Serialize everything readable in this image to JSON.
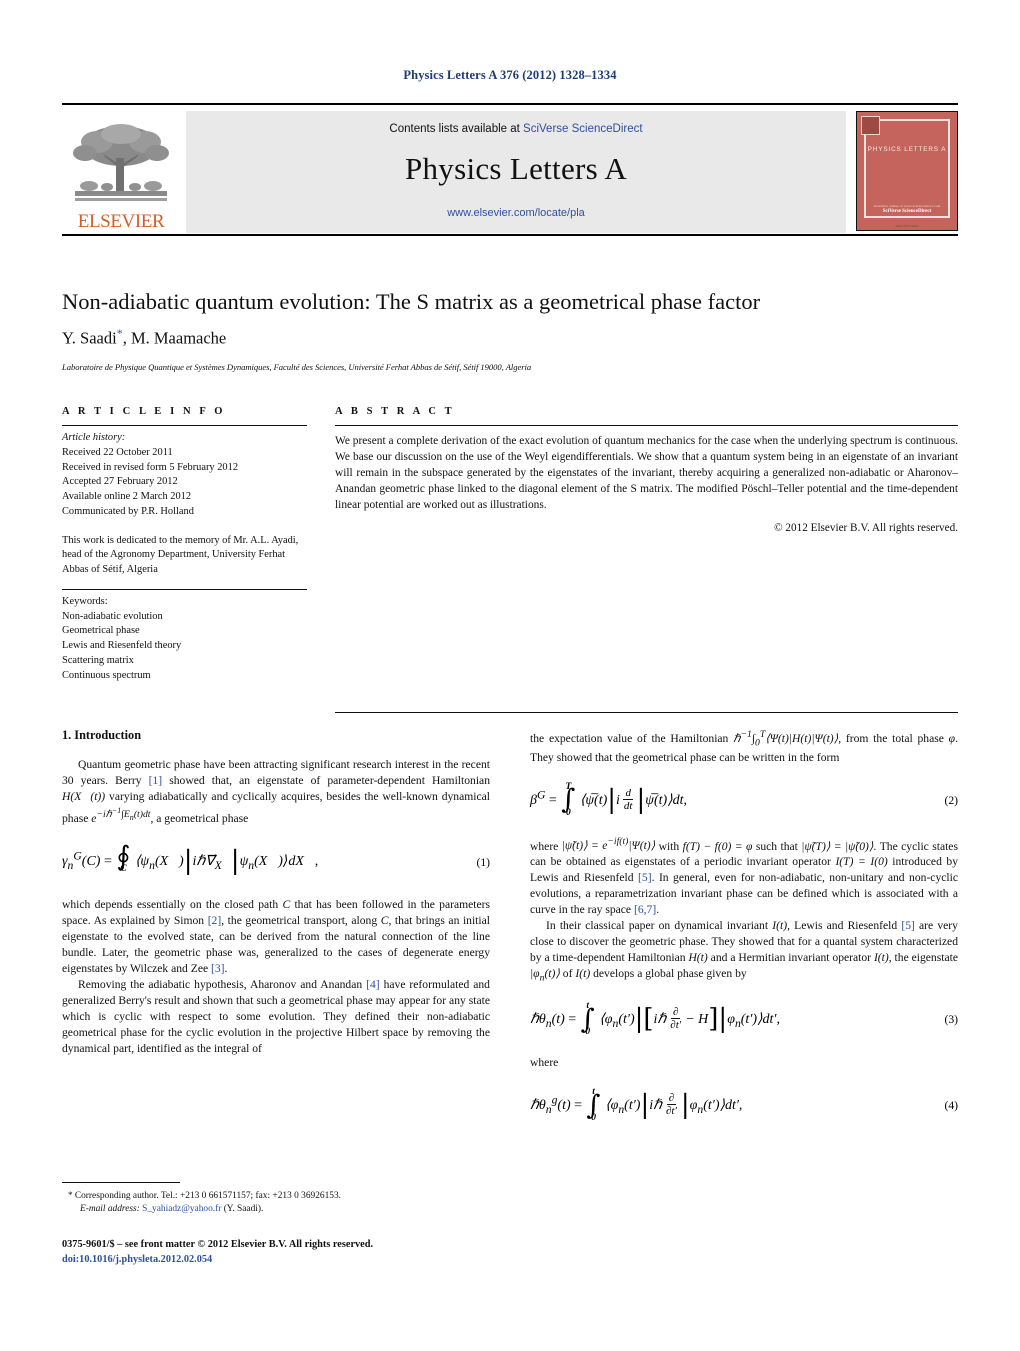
{
  "running_head": "Physics Letters A 376 (2012) 1328–1334",
  "masthead": {
    "contents_prefix": "Contents lists available at ",
    "contents_link": "SciVerse ScienceDirect",
    "journal_title": "Physics Letters A",
    "journal_url": "www.elsevier.com/locate/pla",
    "publisher_word": "ELSEVIER",
    "cover": {
      "name": "PHYSICS LETTERS A",
      "foot1": "Available online at www.sciencedirect.com",
      "foot2": "SciVerse ScienceDirect",
      "foot3": "ISSN 0375-9601"
    },
    "colors": {
      "link": "#2d4fa0",
      "band": "#e9e9e9",
      "elsevier_orange": "#d25f26",
      "cover_red": "#c4645c"
    }
  },
  "title": "Non-adiabatic quantum evolution: The S matrix as a geometrical phase factor",
  "authors": "Y. Saadi",
  "authors_rest": ", M. Maamache",
  "author_marker": "*",
  "affiliation": "Laboratoire de Physique Quantique et Systèmes Dynamiques, Faculté des Sciences, Université Ferhat Abbas de Sétif, Sétif 19000, Algeria",
  "article_info": {
    "heading": "A R T I C L E    I N F O",
    "history_label": "Article history:",
    "history": [
      "Received 22 October 2011",
      "Received in revised form 5 February 2012",
      "Accepted 27 February 2012",
      "Available online 2 March 2012",
      "Communicated by P.R. Holland"
    ],
    "dedication": "This work is dedicated to the memory of Mr. A.L. Ayadi, head of the Agronomy Department, University Ferhat Abbas of Sétif, Algeria",
    "keywords_label": "Keywords:",
    "keywords": [
      "Non-adiabatic evolution",
      "Geometrical phase",
      "Lewis and Riesenfeld theory",
      "Scattering matrix",
      "Continuous spectrum"
    ]
  },
  "abstract": {
    "heading": "A B S T R A C T",
    "text": "We present a complete derivation of the exact evolution of quantum mechanics for the case when the underlying spectrum is continuous. We base our discussion on the use of the Weyl eigendifferentials. We show that a quantum system being in an eigenstate of an invariant will remain in the subspace generated by the eigenstates of the invariant, thereby acquiring a generalized non-adiabatic or Aharonov–Anandan geometric phase linked to the diagonal element of the S matrix. The modified Pöschl–Teller potential and the time-dependent linear potential are worked out as illustrations.",
    "copyright": "© 2012 Elsevier B.V. All rights reserved."
  },
  "body": {
    "section1_title": "1. Introduction",
    "left_p1_a": "Quantum geometric phase have been attracting significant research interest in the recent 30 years. Berry ",
    "left_p1_ref": "[1]",
    "left_p1_b": " showed that, an eigenstate of parameter-dependent Hamiltonian ",
    "left_p1_math1": "H(X⃗(t))",
    "left_p1_c": " varying adiabatically and cyclically acquires, besides the well-known dynamical phase ",
    "left_p1_d": ", a geometrical phase",
    "eq1_num": "(1)",
    "left_p2_a": "which depends essentially on the closed path ",
    "left_p2_C": "C",
    "left_p2_b": " that has been followed in the parameters space. As explained by Simon ",
    "left_p2_ref2": "[2]",
    "left_p2_c": ", the geometrical transport, along ",
    "left_p2_d": ", that brings an initial eigenstate to the evolved state, can be derived from the natural connection of the line bundle. Later, the geometric phase was, generalized to the cases of degenerate energy eigenstates by Wilczek and Zee ",
    "left_p2_ref3": "[3]",
    "left_p2_e": ".",
    "left_p3_a": "Removing the adiabatic hypothesis, Aharonov and Anandan ",
    "left_p3_ref": "[4]",
    "left_p3_b": " have reformulated and generalized Berry's result and shown that such a geometrical phase may appear for any state which is cyclic with respect to some evolution. They defined their non-adiabatic geometrical phase for the cyclic evolution in the projective Hilbert space by removing the dynamical part, identified as the integral of",
    "right_p1_a": "the expectation value of the Hamiltonian ",
    "right_p1_b": ", from the total phase ",
    "right_p1_phi": "φ",
    "right_p1_c": ". They showed that the geometrical phase can be written in the form",
    "eq2_num": "(2)",
    "right_p2_a": "where ",
    "right_p2_b": " with ",
    "right_p2_c": " such that ",
    "right_p2_d": ". The cyclic states can be obtained as eigenstates of a periodic invariant operator ",
    "right_p2_e": " introduced by Lewis and Riesenfeld ",
    "right_p2_ref5": "[5]",
    "right_p2_f": ". In general, even for non-adiabatic, non-unitary and non-cyclic evolutions, a reparametrization invariant phase can be defined which is associated with a curve in the ray space ",
    "right_p2_ref67": "[6,7]",
    "right_p2_g": ".",
    "right_p3_a": "In their classical paper on dynamical invariant ",
    "right_p3_b": ", Lewis and Riesenfeld ",
    "right_p3_ref5": "[5]",
    "right_p3_c": " are very close to discover the geometric phase. They showed that for a quantal system characterized by a time-dependent Hamiltonian ",
    "right_p3_d": " and a Hermitian invariant operator ",
    "right_p3_e": ", the eigenstate ",
    "right_p3_f": " of ",
    "right_p3_g": " develops a global phase given by",
    "eq3_num": "(3)",
    "right_where": "where",
    "eq4_num": "(4)"
  },
  "footnote": {
    "marker": "*",
    "line1": "Corresponding author. Tel.: +213 0 661571157; fax: +213 0 36926153.",
    "email_label": "E-mail address:",
    "email": "S_yahiadz@yahoo.fr",
    "email_owner": "(Y. Saadi).",
    "imprint": "0375-9601/$ – see front matter  © 2012 Elsevier B.V. All rights reserved.",
    "doi": "doi:10.1016/j.physleta.2012.02.054"
  }
}
